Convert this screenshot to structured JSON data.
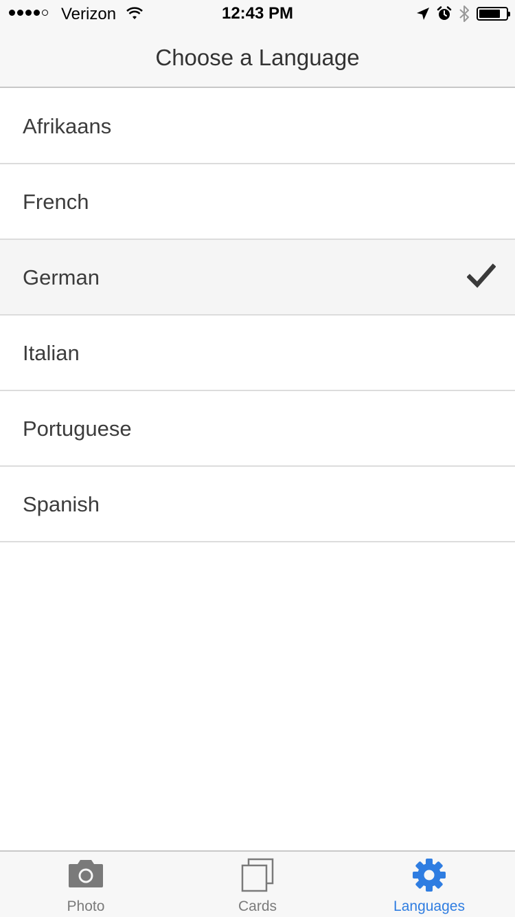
{
  "status_bar": {
    "carrier": "Verizon",
    "time": "12:43 PM",
    "signal_bars": 4,
    "signal_max": 5,
    "battery_level": 0.8,
    "icons": [
      "wifi-icon",
      "location-arrow-icon",
      "alarm-icon",
      "bluetooth-icon",
      "battery-icon"
    ]
  },
  "nav": {
    "title": "Choose a Language"
  },
  "languages": [
    {
      "label": "Afrikaans",
      "selected": false
    },
    {
      "label": "French",
      "selected": false
    },
    {
      "label": "German",
      "selected": true
    },
    {
      "label": "Italian",
      "selected": false
    },
    {
      "label": "Portuguese",
      "selected": false
    },
    {
      "label": "Spanish",
      "selected": false
    }
  ],
  "tabs": [
    {
      "label": "Photo",
      "icon": "camera-icon",
      "active": false
    },
    {
      "label": "Cards",
      "icon": "cards-icon",
      "active": false
    },
    {
      "label": "Languages",
      "icon": "gear-icon",
      "active": true
    }
  ],
  "colors": {
    "accent": "#2f7de1",
    "inactive_tab": "#7a7a7a",
    "selected_row": "#f5f5f5"
  }
}
